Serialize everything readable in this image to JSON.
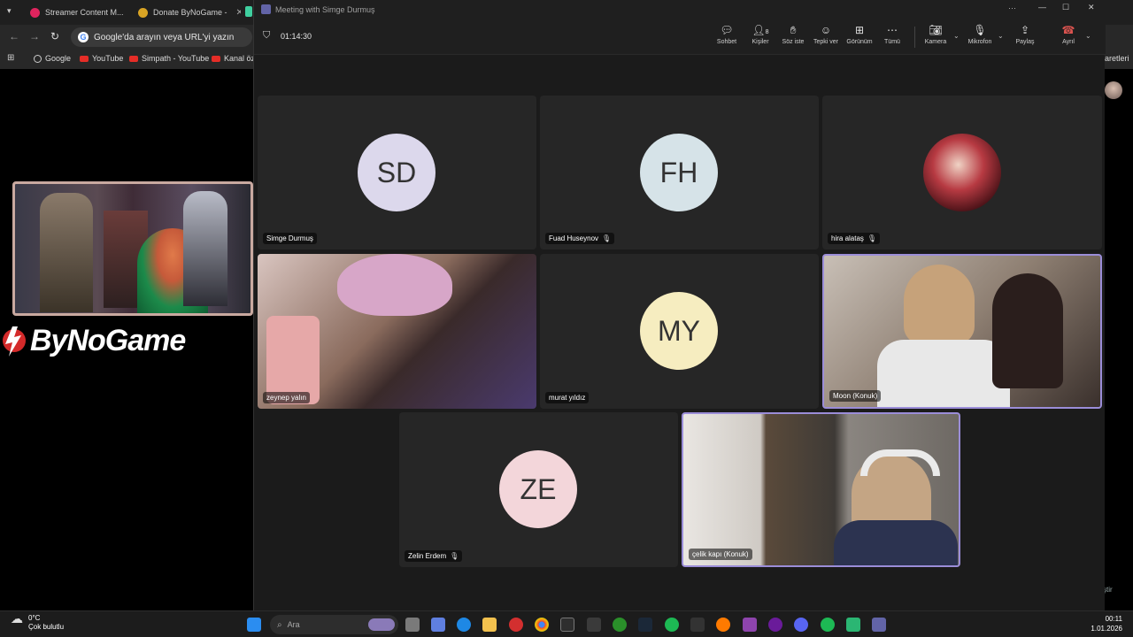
{
  "browser": {
    "tabs": [
      {
        "label": "Streamer Content M..."
      },
      {
        "label": "Donate ByNoGame -"
      }
    ],
    "omnibox_placeholder": "Google'da arayın veya URL'yi yazın",
    "bookmarks": [
      "Google",
      "YouTube",
      "Simpath - YouTube",
      "Kanal öze"
    ],
    "right_edge_text": "aretleri",
    "right_edge_bottom": "ştir"
  },
  "overlay": {
    "brand": "ByNoGame"
  },
  "meeting": {
    "window_title": "Meeting with Simge Durmuş",
    "timer": "01:14:30",
    "toolbar": [
      {
        "label": "Sohbet",
        "icon": "chat-icon"
      },
      {
        "label": "Kişiler",
        "icon": "people-icon",
        "count": "8"
      },
      {
        "label": "Söz iste",
        "icon": "raise-hand-icon"
      },
      {
        "label": "Tepki ver",
        "icon": "react-icon"
      },
      {
        "label": "Görünüm",
        "icon": "view-icon"
      },
      {
        "label": "Tümü",
        "icon": "more-icon"
      },
      {
        "label": "Kamera",
        "icon": "camera-off-icon"
      },
      {
        "label": "Mikrofon",
        "icon": "microphone-icon"
      },
      {
        "label": "Paylaş",
        "icon": "share-icon"
      },
      {
        "label": "Ayrıl",
        "icon": "leave-icon"
      }
    ],
    "participants": [
      {
        "name": "Simge Durmuş",
        "initials": "SD",
        "avatar_color": "#dcd8ec",
        "muted": false
      },
      {
        "name": "Fuad Huseynov",
        "initials": "FH",
        "avatar_color": "#d6e3e8",
        "muted": true
      },
      {
        "name": "hira alataş",
        "initials": "",
        "avatar_color": "#7a1a22",
        "muted": true
      },
      {
        "name": "zeynep yalın",
        "initials": "",
        "avatar_color": "#c9a99a",
        "muted": false
      },
      {
        "name": "murat yıldız",
        "initials": "MY",
        "avatar_color": "#f6edc0",
        "muted": false
      },
      {
        "name": "Moon (Konuk)",
        "initials": "",
        "avatar_color": "#b9a897",
        "muted": false
      },
      {
        "name": "Zelin Erdem",
        "initials": "ZE",
        "avatar_color": "#f3d6da",
        "muted": true
      },
      {
        "name": "çelik kapı (Konuk)",
        "initials": "",
        "avatar_color": "#8c8984",
        "muted": false
      }
    ]
  },
  "taskbar": {
    "weather_temp": "0°C",
    "weather_desc": "Çok bulutlu",
    "search_placeholder": "Ara",
    "time": "00:11",
    "date": "1.01.2026"
  }
}
